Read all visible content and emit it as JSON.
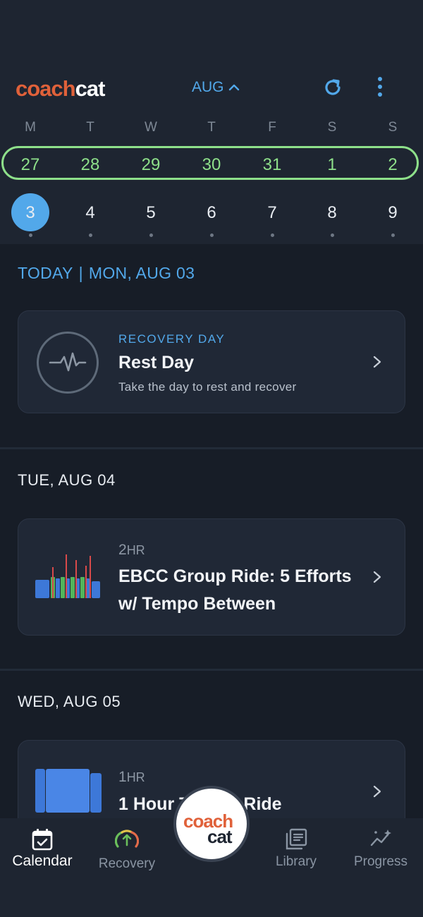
{
  "app": {
    "logo_part1": "coach",
    "logo_part2": "cat",
    "month_label": "AUG",
    "colors": {
      "accent_blue": "#52a8ea",
      "week_green": "#8ee08a",
      "brand_orange": "#e0613a",
      "background": "#171d27"
    }
  },
  "calendar": {
    "weekdays": [
      "M",
      "T",
      "W",
      "T",
      "F",
      "S",
      "S"
    ],
    "prev_week": [
      "27",
      "28",
      "29",
      "30",
      "31",
      "1",
      "2"
    ],
    "current_week": [
      "3",
      "4",
      "5",
      "6",
      "7",
      "8",
      "9"
    ],
    "selected_day": "3"
  },
  "today_header": {
    "label": "TODAY",
    "separator": "|",
    "date": "MON, AUG 03"
  },
  "days": [
    {
      "card": {
        "tag": "RECOVERY DAY",
        "title": "Rest Day",
        "subtitle": "Take the day to rest and recover"
      }
    },
    {
      "date": "TUE, AUG 04",
      "card": {
        "duration_num": "2",
        "duration_unit": "HR",
        "title_line1": "EBCC Group Ride: 5 Efforts",
        "title_line2": "w/ Tempo Between"
      }
    },
    {
      "date": "WED, AUG 05",
      "card": {
        "duration_num": "1",
        "duration_unit": "HR",
        "title_left": "1 Hour T",
        "title_right": "Ride"
      }
    }
  ],
  "nav": {
    "calendar": "Calendar",
    "recovery": "Recovery",
    "library": "Library",
    "progress": "Progress",
    "center_part1": "coach",
    "center_part2": "cat"
  }
}
